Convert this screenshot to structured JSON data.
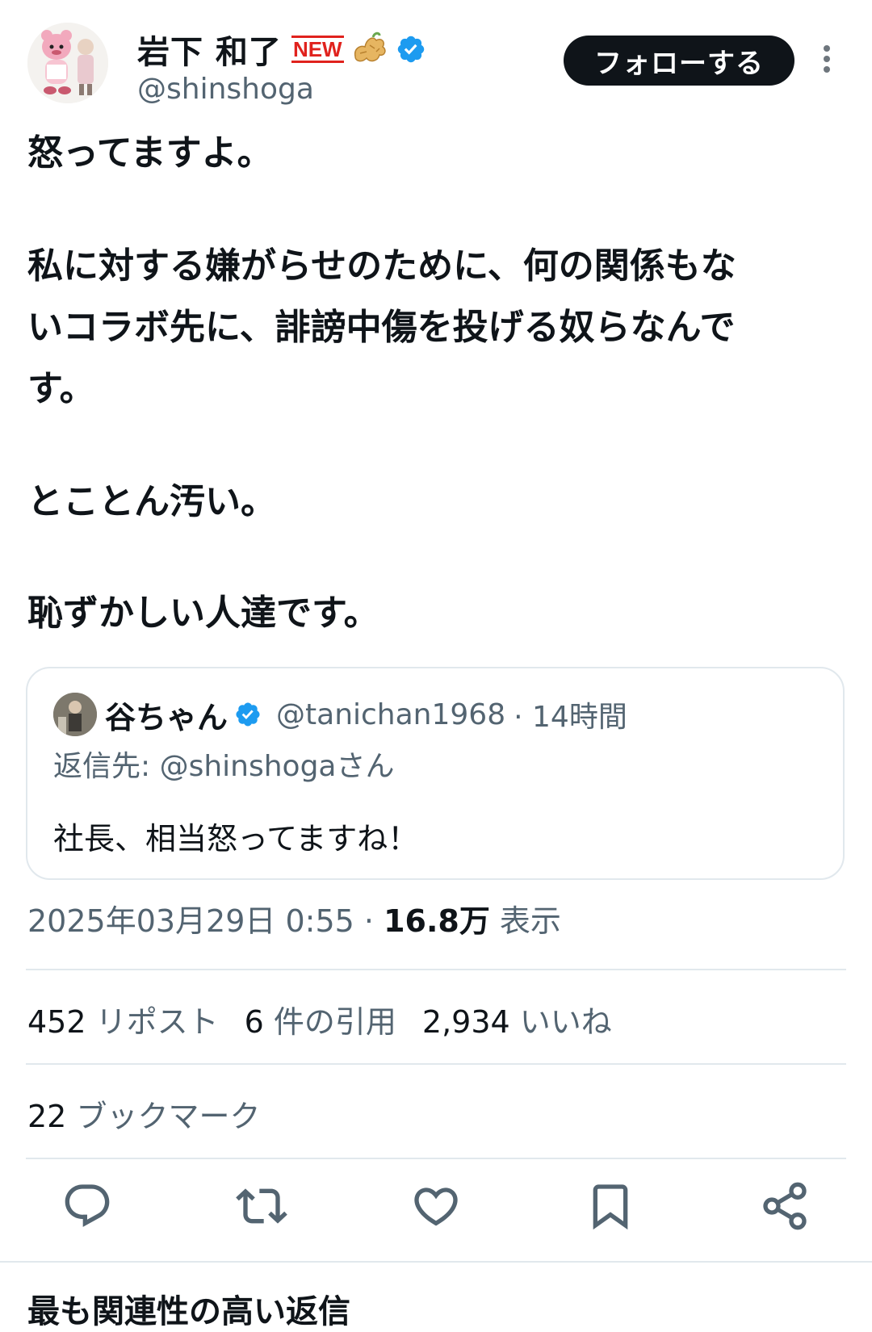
{
  "author": {
    "name": "岩下 和了",
    "badge": "NEW",
    "handle": "@shinshoga",
    "follow_label": "フォローする"
  },
  "post": {
    "lines": [
      "怒ってますよ。",
      "私に対する嫌がらせのために、何の関係もな",
      "いコラボ先に、誹謗中傷を投げる奴らなんで",
      "す。",
      "とことん汚い。",
      "恥ずかしい人達です。"
    ]
  },
  "quote": {
    "name": "谷ちゃん",
    "handle": "@tanichan1968",
    "time": "· 14時間",
    "reply_prefix": "返信先: ",
    "reply_mention": "@shinshoga",
    "reply_suffix": "さん",
    "text": "社長、相当怒ってますね！"
  },
  "meta": {
    "timestamp": "2025年03月29日 0:55 · ",
    "views_count": "16.8万",
    "views_label": " 表示"
  },
  "stats": {
    "reposts_count": "452",
    "reposts_label": " リポスト",
    "quotes_count": "6",
    "quotes_label": " 件の引用",
    "likes_count": "2,934",
    "likes_label": " いいね",
    "bookmarks_count": "22",
    "bookmarks_label": " ブックマーク"
  },
  "next_section": "最も関連性の高い返信",
  "icons": [
    "reply-icon",
    "repost-icon",
    "like-icon",
    "bookmark-icon",
    "share-icon",
    "verified-icon",
    "more-icon"
  ],
  "colors": {
    "verified": "#1d9bf0",
    "text": "#0f1419",
    "secondary": "#536471",
    "button": "#0f1419",
    "badge": "#e0221d"
  }
}
